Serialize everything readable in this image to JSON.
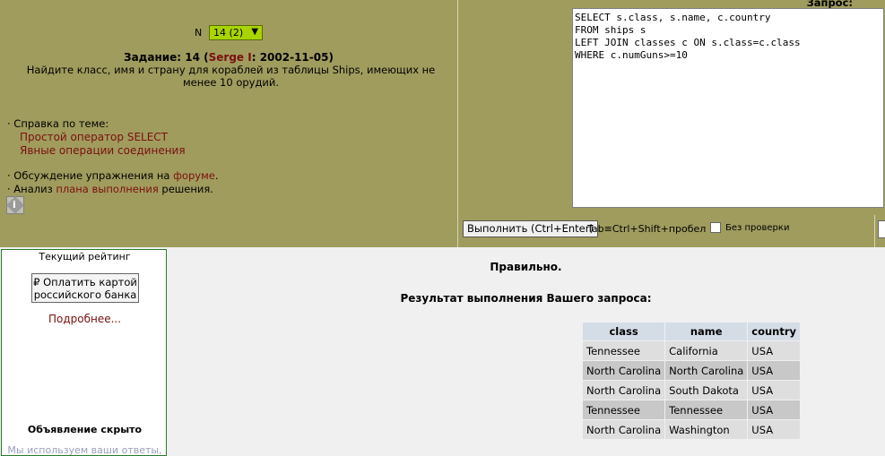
{
  "task_selector": {
    "label": "N",
    "value": "14 (2)"
  },
  "task": {
    "prefix": "Задание: 14 (",
    "author": "Serge I",
    "suffix": ": 2002-11-05)",
    "text": "Найдите класс, имя и страну для кораблей из таблицы Ships, имеющих не менее 10 орудий."
  },
  "help": {
    "heading": "· Справка по теме:",
    "links": [
      "Простой оператор SELECT",
      "Явные операции соединения"
    ]
  },
  "discussion": {
    "forum_prefix": "· Обсуждение упражнения на ",
    "forum_link": "форуме",
    "forum_suffix": ".",
    "plan_prefix": "· Анализ ",
    "plan_link": "плана выполнения",
    "plan_suffix": " решения."
  },
  "info_icon": {
    "icon": "info-icon",
    "glyph": "i"
  },
  "query": {
    "label": "Запрос:",
    "text": "SELECT s.class, s.name, c.country\nFROM ships s\nLEFT JOIN classes c ON s.class=c.class\nWHERE c.numGuns>=10"
  },
  "toolbar": {
    "run_label": "Выполнить (Ctrl+Enter)",
    "tab_hint": "Tab≡Ctrl+Shift+пробел",
    "noverify_label": "Без проверки"
  },
  "sidebar": {
    "rating_title": "Текущий рейтинг",
    "pay_label": "₽ Оплатить картой российского банка",
    "more_link": "Подробнее...",
    "ad_hidden": "Объявление скрыто",
    "ad_note": "Мы используем ваши ответы,"
  },
  "result": {
    "status": "Правильно.",
    "title": "Результат выполнения Вашего запроса:",
    "columns": [
      "class",
      "name",
      "country"
    ],
    "rows": [
      [
        "Tennessee",
        "California",
        "USA"
      ],
      [
        "North Carolina",
        "North Carolina",
        "USA"
      ],
      [
        "North Carolina",
        "South Dakota",
        "USA"
      ],
      [
        "Tennessee",
        "Tennessee",
        "USA"
      ],
      [
        "North Carolina",
        "Washington",
        "USA"
      ]
    ]
  },
  "colors": {
    "panel_bg": "#a09c5e",
    "link": "#7a1010",
    "select_bg": "#a8d400",
    "table_header": "#d4dde6"
  }
}
